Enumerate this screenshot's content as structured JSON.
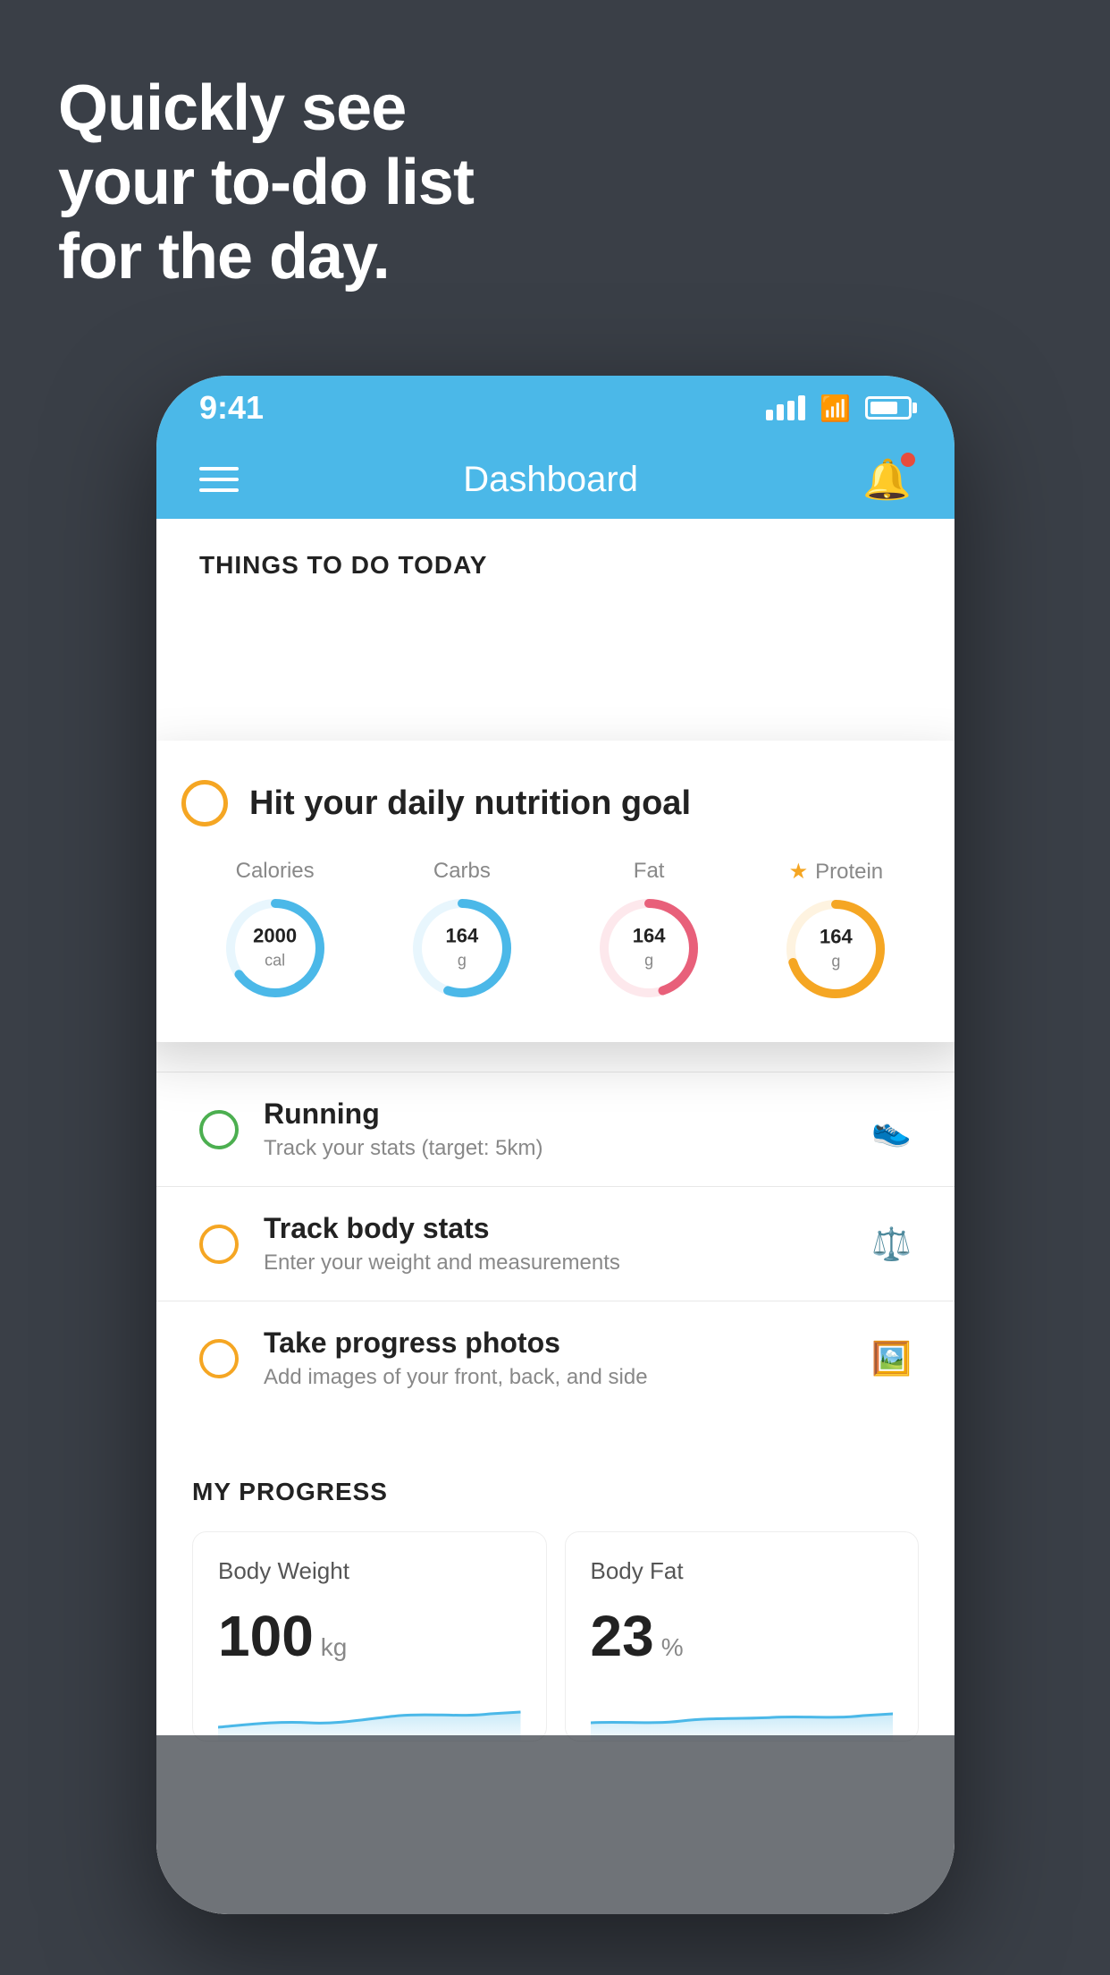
{
  "headline": {
    "line1": "Quickly see",
    "line2": "your to-do list",
    "line3": "for the day."
  },
  "phone": {
    "statusBar": {
      "time": "9:41"
    },
    "navBar": {
      "title": "Dashboard"
    },
    "thingsSection": {
      "title": "THINGS TO DO TODAY"
    },
    "floatingCard": {
      "circleColor": "#f5a623",
      "title": "Hit your daily nutrition goal",
      "nutrition": [
        {
          "label": "Calories",
          "value": "2000",
          "unit": "cal",
          "color": "#4bb8e8",
          "trackColor": "#e8f6fd",
          "percent": 65
        },
        {
          "label": "Carbs",
          "value": "164",
          "unit": "g",
          "color": "#4bb8e8",
          "trackColor": "#e8f6fd",
          "percent": 55
        },
        {
          "label": "Fat",
          "value": "164",
          "unit": "g",
          "color": "#e8607a",
          "trackColor": "#fde8ec",
          "percent": 45
        },
        {
          "label": "Protein",
          "value": "164",
          "unit": "g",
          "color": "#f5a623",
          "trackColor": "#fef3e0",
          "percent": 70,
          "starred": true
        }
      ]
    },
    "todoItems": [
      {
        "name": "Running",
        "desc": "Track your stats (target: 5km)",
        "circleType": "green",
        "icon": "shoe"
      },
      {
        "name": "Track body stats",
        "desc": "Enter your weight and measurements",
        "circleType": "yellow",
        "icon": "scale"
      },
      {
        "name": "Take progress photos",
        "desc": "Add images of your front, back, and side",
        "circleType": "yellow",
        "icon": "person"
      }
    ],
    "progressSection": {
      "title": "MY PROGRESS",
      "cards": [
        {
          "title": "Body Weight",
          "value": "100",
          "unit": "kg"
        },
        {
          "title": "Body Fat",
          "value": "23",
          "unit": "%"
        }
      ]
    }
  }
}
